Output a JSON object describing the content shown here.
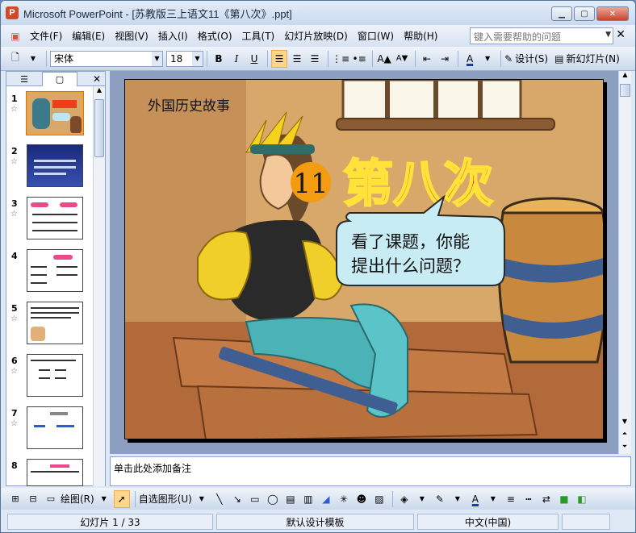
{
  "window": {
    "title": "Microsoft PowerPoint - [苏教版三上语文11《第八次》.ppt]"
  },
  "menu": [
    "文件(F)",
    "编辑(E)",
    "视图(V)",
    "插入(I)",
    "格式(O)",
    "工具(T)",
    "幻灯片放映(D)",
    "窗口(W)",
    "帮助(H)"
  ],
  "help_placeholder": "键入需要帮助的问题",
  "toolbar": {
    "font": "宋体",
    "size": "18",
    "bold": "B",
    "italic": "I",
    "underline": "U",
    "design": "设计(S)",
    "new_slide": "新幻灯片(N)"
  },
  "thumbnails": [
    {
      "num": "1",
      "star": "☆"
    },
    {
      "num": "2",
      "star": "☆"
    },
    {
      "num": "3",
      "star": "☆"
    },
    {
      "num": "4",
      "star": ""
    },
    {
      "num": "5",
      "star": "☆"
    },
    {
      "num": "6",
      "star": "☆"
    },
    {
      "num": "7",
      "star": "☆"
    },
    {
      "num": "8",
      "star": ""
    }
  ],
  "slide": {
    "subtitle": "外国历史故事",
    "lesson_number": "11",
    "title": "第八次",
    "bubble_line1": "看了课题，你能",
    "bubble_line2": "提出什么问题？"
  },
  "notes_placeholder": "单击此处添加备注",
  "drawbar": {
    "draw": "绘图(R)",
    "autoshapes": "自选图形(U)"
  },
  "status": {
    "slide": "幻灯片 1 / 33",
    "template": "默认设计模板",
    "language": "中文(中国)"
  },
  "colors": {
    "title_red": "#f03c1a",
    "title_outline": "#ffe23a",
    "wall": "#d8a86a",
    "circle": "#f39c12"
  }
}
